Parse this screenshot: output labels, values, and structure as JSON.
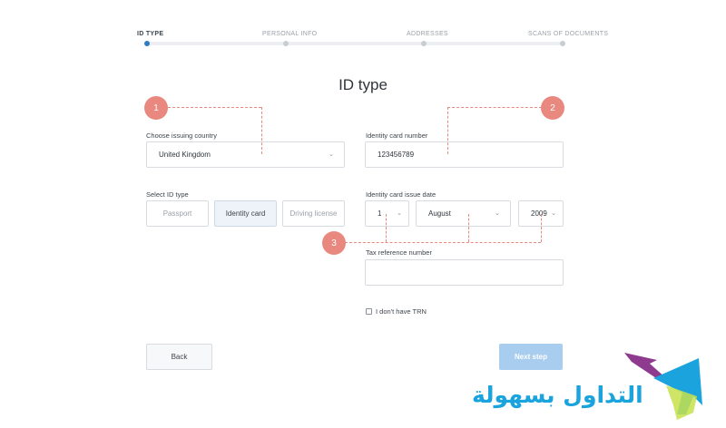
{
  "stepper": {
    "steps": [
      {
        "label": "ID TYPE",
        "active": true
      },
      {
        "label": "PERSONAL INFO",
        "active": false
      },
      {
        "label": "ADDRESSES",
        "active": false
      },
      {
        "label": "SCANS OF DOCUMENTS",
        "active": false
      }
    ]
  },
  "page_title": "ID type",
  "country": {
    "label": "Choose issuing country",
    "value": "United Kingdom"
  },
  "id_type": {
    "label": "Select ID type",
    "options": [
      "Passport",
      "Identity card",
      "Driving license"
    ],
    "selected": "Identity card"
  },
  "card_number": {
    "label": "Identity card number",
    "value": "123456789"
  },
  "issue_date": {
    "label": "Identity card issue date",
    "day": "1",
    "month": "August",
    "year": "2009"
  },
  "tax": {
    "label": "Tax reference number",
    "value": ""
  },
  "no_trn": {
    "label": "I don't have TRN",
    "checked": false
  },
  "buttons": {
    "back": "Back",
    "next": "Next step"
  },
  "annotations": {
    "marker_1": "1",
    "marker_2": "2",
    "marker_3": "3",
    "color": "#e8887f"
  },
  "watermark": {
    "text": "التداول بسهولة",
    "colors": [
      "#1aa3dc",
      "#8e3a8f",
      "#c7e14a"
    ]
  },
  "colors": {
    "accent": "#2f7ec4",
    "next_button": "#a9cdef"
  }
}
